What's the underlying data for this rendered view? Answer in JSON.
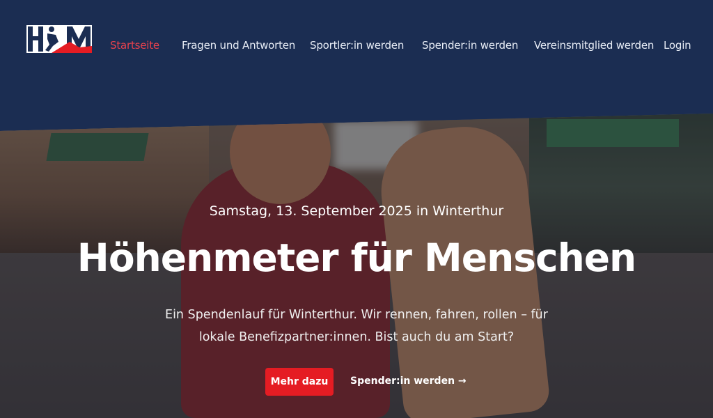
{
  "brand": {
    "logo_text": "HfM",
    "accent_red": "#e51c23",
    "navy": "#1b2d52"
  },
  "nav": {
    "items": [
      {
        "label": "Startseite",
        "active": true
      },
      {
        "label": "Fragen und Antworten",
        "active": false
      },
      {
        "label": "Sportler:in werden",
        "active": false
      },
      {
        "label": "Spender:in werden",
        "active": false
      },
      {
        "label": "Vereinsmitglied werden",
        "active": false
      },
      {
        "label": "Login",
        "active": false
      }
    ]
  },
  "hero": {
    "date_line": "Samstag, 13. September 2025 in Winterthur",
    "title": "Höhenmeter für Menschen",
    "description": "Ein Spendenlauf für Winterthur. Wir rennen, fahren, rollen – für lokale Benefizpartner:innen. Bist auch du am Start?",
    "primary_button": "Mehr dazu",
    "secondary_link": "Spender:in werden →"
  }
}
